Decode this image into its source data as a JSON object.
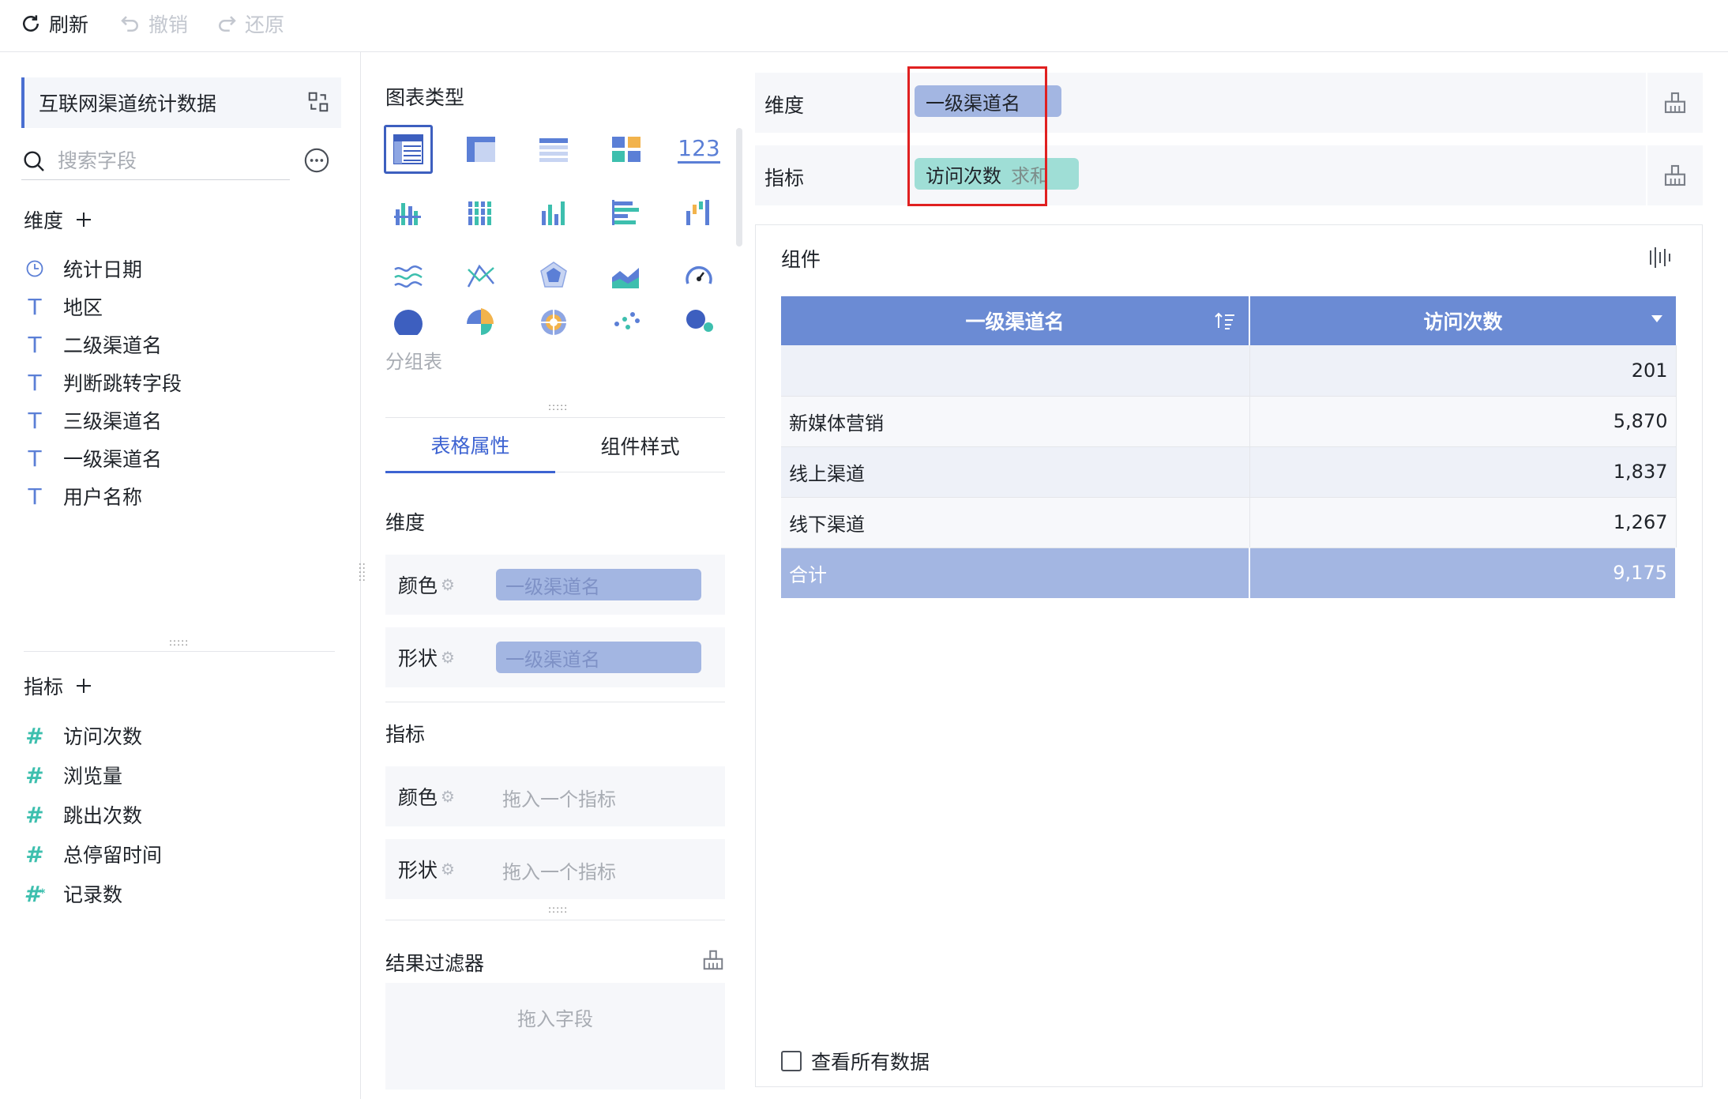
{
  "toolbar": {
    "refresh_label": "刷新",
    "undo_label": "撤销",
    "redo_label": "还原"
  },
  "left": {
    "dataset_name": "互联网渠道统计数据",
    "search_placeholder": "搜索字段",
    "dimension_title": "维度",
    "dimensions": [
      {
        "label": "统计日期",
        "icon": "clock-icon"
      },
      {
        "label": "地区",
        "icon": "text-type-icon"
      },
      {
        "label": "二级渠道名",
        "icon": "text-type-icon"
      },
      {
        "label": "判断跳转字段",
        "icon": "text-type-icon"
      },
      {
        "label": "三级渠道名",
        "icon": "text-type-icon"
      },
      {
        "label": "一级渠道名",
        "icon": "text-type-icon"
      },
      {
        "label": "用户名称",
        "icon": "text-type-icon"
      }
    ],
    "measure_title": "指标",
    "measures": [
      {
        "label": "访问次数",
        "icon": "hash-icon"
      },
      {
        "label": "浏览量",
        "icon": "hash-icon"
      },
      {
        "label": "跳出次数",
        "icon": "hash-icon"
      },
      {
        "label": "总停留时间",
        "icon": "hash-icon"
      },
      {
        "label": "记录数",
        "icon": "hash-star-icon"
      }
    ]
  },
  "middle": {
    "chart_type_title": "图表类型",
    "chart_type_tooltip": "分组表",
    "chart_type_123": "123",
    "tabs": [
      "表格属性",
      "组件样式"
    ],
    "dimension_section": "维度",
    "dim_color_label": "颜色",
    "dim_color_value": "一级渠道名",
    "dim_shape_label": "形状",
    "dim_shape_value": "一级渠道名",
    "measure_section": "指标",
    "mea_color_label": "颜色",
    "mea_color_hint": "拖入一个指标",
    "mea_shape_label": "形状",
    "mea_shape_hint": "拖入一个指标",
    "result_filter_title": "结果过滤器",
    "filter_drop_hint": "拖入字段"
  },
  "right": {
    "dim_shelf_label": "维度",
    "dim_shelf_field": "一级渠道名",
    "mea_shelf_label": "指标",
    "mea_shelf_field": "访问次数",
    "mea_shelf_agg": "求和",
    "component_title": "组件",
    "table": {
      "headers": [
        "一级渠道名",
        "访问次数"
      ],
      "rows": [
        [
          "",
          "201"
        ],
        [
          "新媒体营销",
          "5,870"
        ],
        [
          "线上渠道",
          "1,837"
        ],
        [
          "线下渠道",
          "1,267"
        ]
      ],
      "total": [
        "合计",
        "9,175"
      ]
    },
    "view_all_label": "查看所有数据"
  },
  "colors": {
    "accent": "#3d63d2",
    "table_header": "#6b8bd4",
    "total_row": "#a3b6e2",
    "measure_icon": "#3dbfae",
    "highlight_box": "#e02020"
  }
}
